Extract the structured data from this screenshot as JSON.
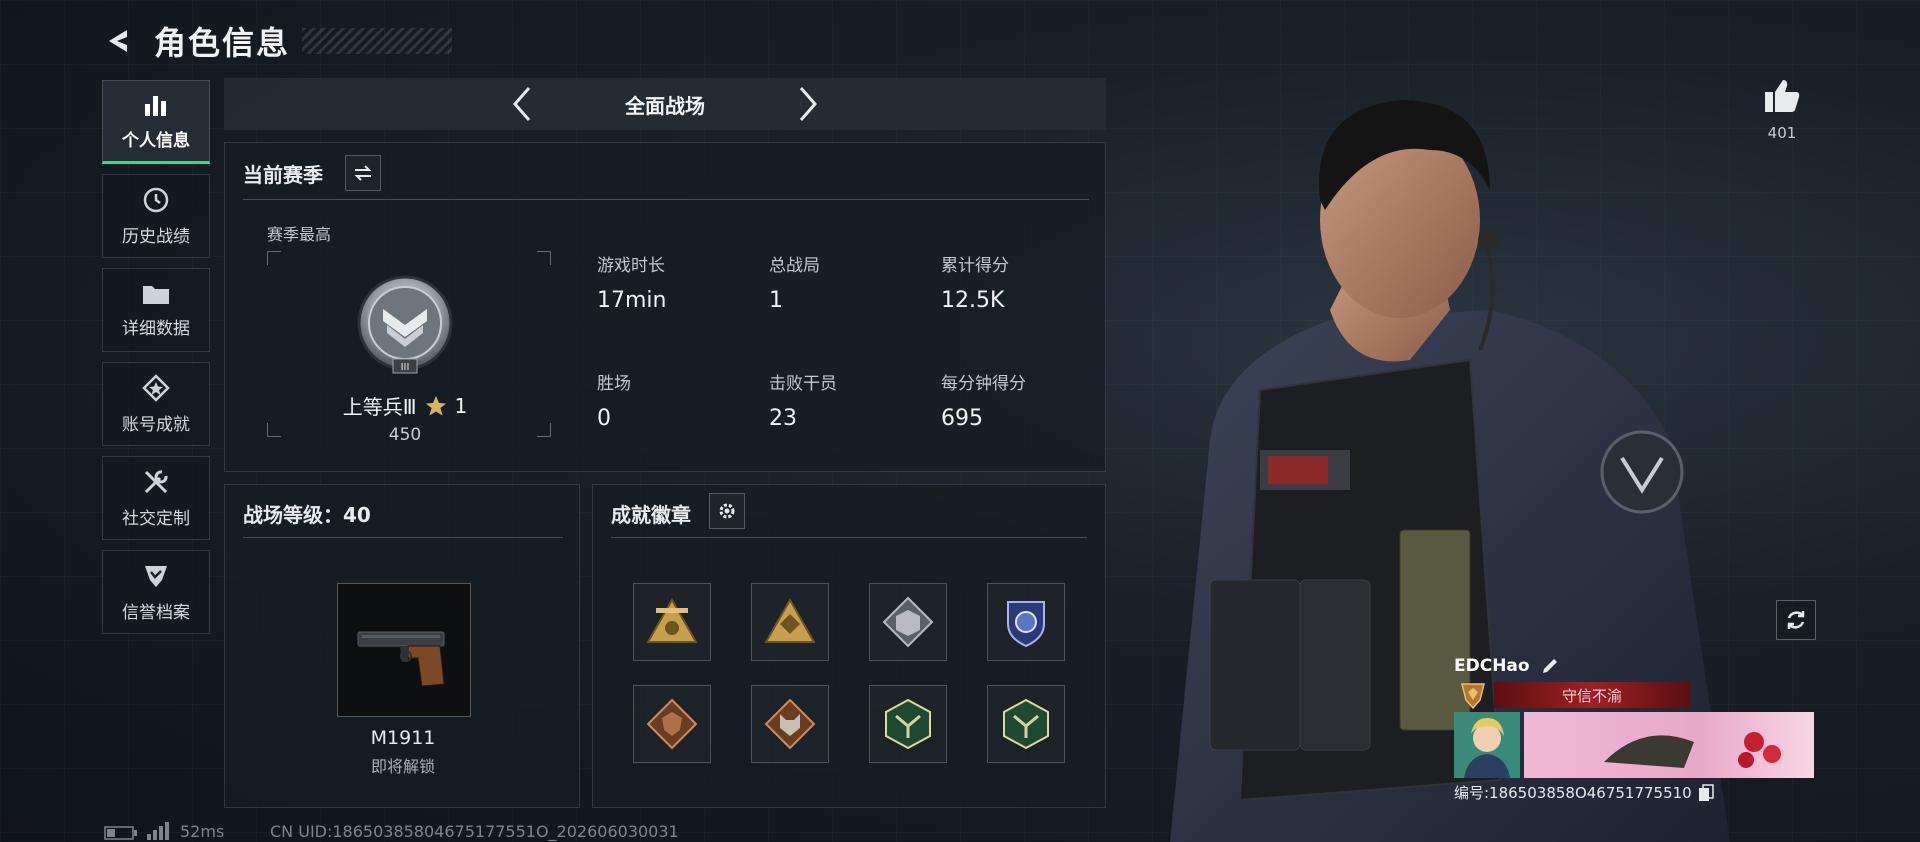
{
  "header": {
    "title": "角色信息"
  },
  "sidebar": {
    "items": [
      {
        "label": "个人信息",
        "icon": "bar-chart-icon",
        "active": true
      },
      {
        "label": "历史战绩",
        "icon": "clock-badge-icon",
        "active": false
      },
      {
        "label": "详细数据",
        "icon": "folder-icon",
        "active": false
      },
      {
        "label": "账号成就",
        "icon": "achievement-star-icon",
        "active": false
      },
      {
        "label": "社交定制",
        "icon": "tools-icon",
        "active": false
      },
      {
        "label": "信誉档案",
        "icon": "shield-check-icon",
        "active": false
      }
    ]
  },
  "mode": {
    "title": "全面战场"
  },
  "season": {
    "section_title": "当前赛季",
    "best_label": "赛季最高",
    "rank_name": "上等兵Ⅲ",
    "stars": "1",
    "rank_points": "450",
    "stats": [
      {
        "label": "游戏时长",
        "value": "17min"
      },
      {
        "label": "总战局",
        "value": "1"
      },
      {
        "label": "累计得分",
        "value": "12.5K"
      },
      {
        "label": "胜场",
        "value": "0"
      },
      {
        "label": "击败干员",
        "value": "23"
      },
      {
        "label": "每分钟得分",
        "value": "695"
      }
    ]
  },
  "battlefield_level": {
    "label": "战场等级：40"
  },
  "weapon": {
    "name": "M1911",
    "status": "即将解锁"
  },
  "badges": {
    "section_title": "成就徽章",
    "items": [
      {
        "icon": "gold-triangle-emblem-icon",
        "color": "#c9a04a"
      },
      {
        "icon": "gold-triangle-emblem-icon",
        "color": "#c9a04a"
      },
      {
        "icon": "silver-cube-emblem-icon",
        "color": "#b8bcc2"
      },
      {
        "icon": "blue-shield-emblem-icon",
        "color": "#5a74c8"
      },
      {
        "icon": "bronze-dragon-emblem-icon",
        "color": "#b07048"
      },
      {
        "icon": "bronze-wolf-emblem-icon",
        "color": "#b07048"
      },
      {
        "icon": "green-hex-emblem-icon",
        "color": "#3f8a5a"
      },
      {
        "icon": "green-hex-emblem-icon",
        "color": "#3f8a5a"
      }
    ]
  },
  "footer": {
    "ping": "52ms",
    "uid_line": "CN UID:18650385804675177551O_202606030031"
  },
  "social": {
    "likes": "401"
  },
  "player": {
    "name": "EDCHao",
    "title": "守信不渝",
    "id_line": "编号:186503858O46751775510"
  },
  "colors": {
    "accent": "#3fd68a",
    "title_bar": "#a01f22"
  }
}
